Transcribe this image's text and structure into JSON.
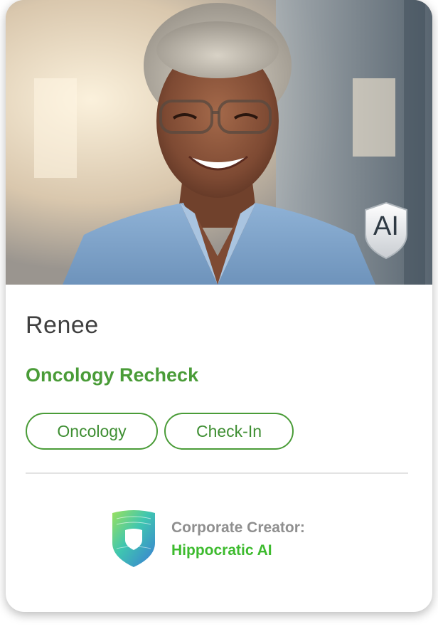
{
  "card": {
    "photo_icon": "person-photo",
    "ai_badge": {
      "label": "AI",
      "icon": "shield-icon"
    },
    "name": "Renee",
    "title": "Oncology Recheck",
    "tags": [
      "Oncology",
      "Check-In"
    ],
    "creator": {
      "label": "Corporate Creator:",
      "name": "Hippocratic AI",
      "logo_icon": "hippocratic-shield-logo"
    }
  },
  "colors": {
    "accent_green": "#4a9c38",
    "creator_green": "#3dbb2e",
    "label_gray": "#8f8f8f"
  }
}
